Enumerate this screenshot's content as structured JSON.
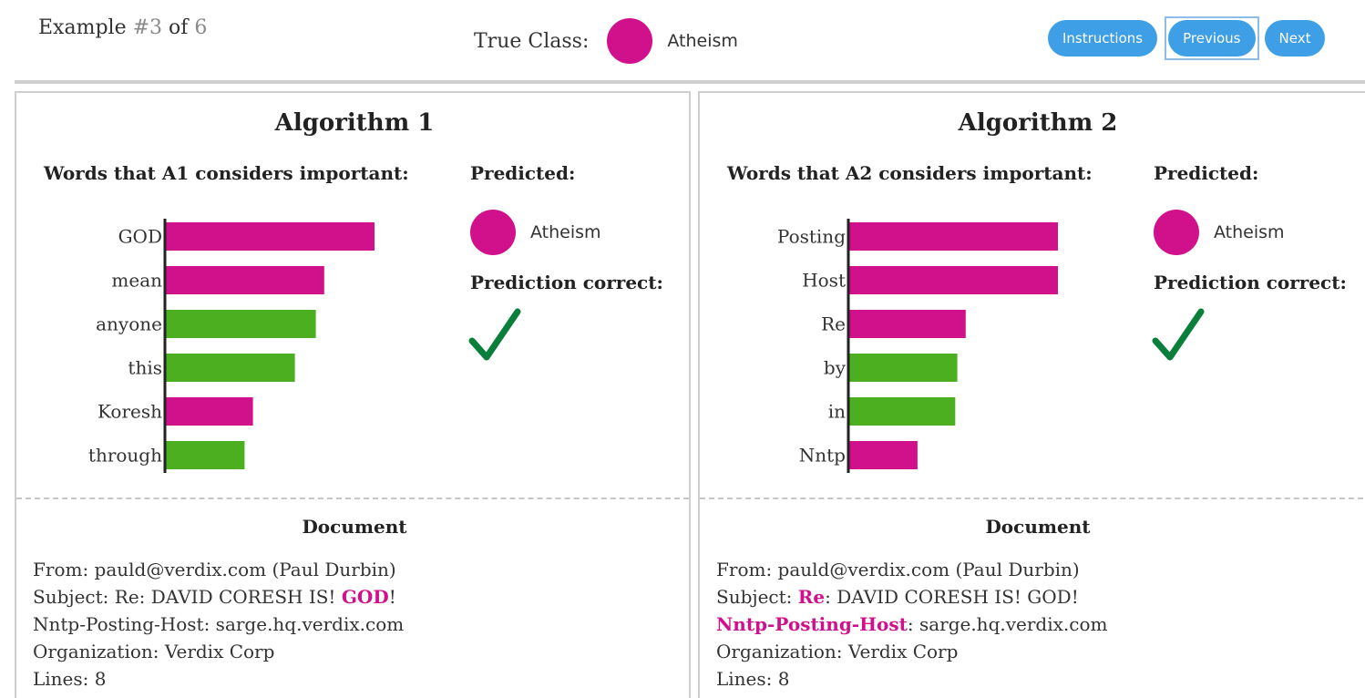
{
  "header": {
    "example_prefix": "Example",
    "example_current": "#3",
    "example_of": "of",
    "example_total": "6",
    "true_class_label": "True Class:",
    "true_class": "Atheism",
    "true_class_color": "#d1118c",
    "buttons": {
      "instructions": "Instructions",
      "previous": "Previous",
      "next": "Next"
    }
  },
  "colors": {
    "atheism": "#d1118c",
    "other": "#4caf1f",
    "button": "#3e9ee6",
    "check": "#0a7f3c"
  },
  "panels": [
    {
      "title": "Algorithm 1",
      "words_title": "Words that A1 considers important:",
      "predicted_label": "Predicted:",
      "predicted_class": "Atheism",
      "correct_label": "Prediction correct:",
      "correct_icon": "checkmark-icon",
      "doc_title": "Document",
      "doc_lines": [
        {
          "prefix": "From: pauld@verdix.com (Paul Durbin)",
          "hl": "",
          "suffix": ""
        },
        {
          "prefix": "Subject: Re: DAVID CORESH IS! ",
          "hl": "GOD",
          "suffix": "!"
        },
        {
          "prefix": "Nntp-Posting-Host: sarge.hq.verdix.com",
          "hl": "",
          "suffix": ""
        },
        {
          "prefix": "Organization: Verdix Corp",
          "hl": "",
          "suffix": ""
        },
        {
          "prefix": "Lines: 8",
          "hl": "",
          "suffix": ""
        }
      ]
    },
    {
      "title": "Algorithm 2",
      "words_title": "Words that A2 considers important:",
      "predicted_label": "Predicted:",
      "predicted_class": "Atheism",
      "correct_label": "Prediction correct:",
      "correct_icon": "checkmark-icon",
      "doc_title": "Document",
      "doc_lines": [
        {
          "prefix": "From: pauld@verdix.com (Paul Durbin)",
          "hl": "",
          "suffix": ""
        },
        {
          "prefix": "Subject: ",
          "hl": "Re",
          "suffix": ": DAVID CORESH IS! GOD!"
        },
        {
          "prefix": "",
          "hl": "Nntp-Posting-Host",
          "suffix": ": sarge.hq.verdix.com"
        },
        {
          "prefix": "Organization: Verdix Corp",
          "hl": "",
          "suffix": ""
        },
        {
          "prefix": "Lines: 8",
          "hl": "",
          "suffix": ""
        }
      ]
    }
  ],
  "chart_data": [
    {
      "type": "bar",
      "orientation": "horizontal",
      "categories": [
        "GOD",
        "mean",
        "anyone",
        "this",
        "Koresh",
        "through"
      ],
      "values": [
        1.0,
        0.76,
        0.72,
        0.62,
        0.42,
        0.38
      ],
      "classes": [
        "atheism",
        "atheism",
        "other",
        "other",
        "atheism",
        "other"
      ],
      "xlim": [
        0,
        1
      ],
      "grid": false
    },
    {
      "type": "bar",
      "orientation": "horizontal",
      "categories": [
        "Posting",
        "Host",
        "Re",
        "by",
        "in",
        "Nntp"
      ],
      "values": [
        1.0,
        1.0,
        0.56,
        0.52,
        0.51,
        0.33
      ],
      "classes": [
        "atheism",
        "atheism",
        "atheism",
        "other",
        "other",
        "atheism"
      ],
      "xlim": [
        0,
        1
      ],
      "grid": false
    }
  ]
}
